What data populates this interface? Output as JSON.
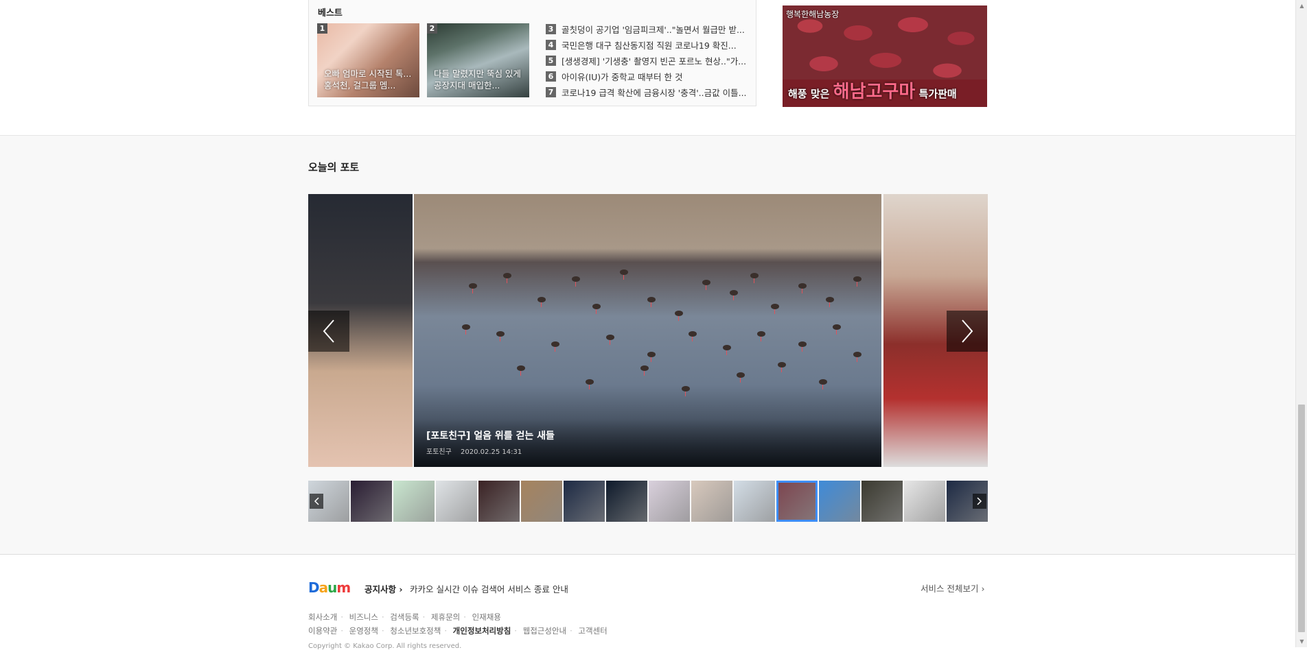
{
  "best": {
    "title": "베스트",
    "cards": [
      {
        "num": "1",
        "caption": "오빠 엄마로 시작된 톡...홍석천, 걸그룹 멤..."
      },
      {
        "num": "2",
        "caption": "다들 말렸지만 뚝심 있게 공장지대 매입한..."
      }
    ],
    "list": [
      {
        "num": "3",
        "text": "골칫덩이 공기업 '임금피크제'..\"놀면서 월급만 받..."
      },
      {
        "num": "4",
        "text": "국민은행 대구 침산동지점 직원 코로나19 확진..."
      },
      {
        "num": "5",
        "text": "[생생경제] '기생충' 촬영지 빈곤 포르노 현상..\"가..."
      },
      {
        "num": "6",
        "text": "아이유(IU)가 중학교 때부터 한 것"
      },
      {
        "num": "7",
        "text": "코로나19 급격 확산에 금융시장 '충격'..금값 이틀..."
      }
    ]
  },
  "ad": {
    "label": "행복한해남농장",
    "text_prefix": "해풍 맞은",
    "text_big": "해남고구마",
    "text_suffix": "특가판매",
    "accent": "#ff6a8a"
  },
  "photo": {
    "section_title": "오늘의 포토",
    "main_caption": "[포토친구] 얼음 위를 걷는 새들",
    "main_source": "포토친구",
    "main_time": "2020.02.25 14:31",
    "prev_icon": "chevron-left-icon",
    "next_icon": "chevron-right-icon",
    "thumbnail_count": 16,
    "selected_thumbnail": 11,
    "thumb_colors": [
      "#cfd6dc",
      "#2a1d33",
      "#c9e6cf",
      "#dfe3e6",
      "#3a2224",
      "#a6835e",
      "#1d2a44",
      "#0e1a2b",
      "#d9d0dc",
      "#d8c9bd",
      "#d3dde6",
      "#7d4650",
      "#3f8bd8",
      "#3b3a30",
      "#e6e6e6",
      "#1d2a44"
    ]
  },
  "footer": {
    "logo_letters": [
      "D",
      "a",
      "u",
      "m"
    ],
    "notice_label": "공지사항",
    "notice_text": "카카오 실시간 이슈 검색어 서비스 종료 안내",
    "all_services": "서비스 전체보기",
    "links_row1": [
      "회사소개",
      "비즈니스",
      "검색등록",
      "제휴문의",
      "인재채용"
    ],
    "links_row2": [
      "이용약관",
      "운영정책",
      "청소년보호정책",
      "개인정보처리방침",
      "웹접근성안내",
      "고객센터"
    ],
    "copyright": "Copyright © Kakao Corp. All rights reserved."
  }
}
